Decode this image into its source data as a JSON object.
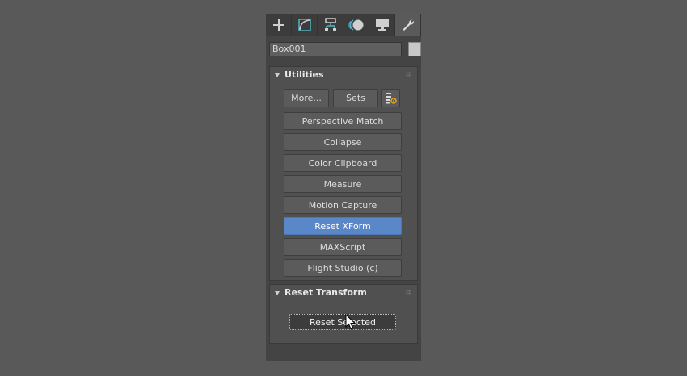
{
  "command_panel": {
    "tabs": [
      {
        "name": "create-tab",
        "icon": "plus-icon"
      },
      {
        "name": "modify-tab",
        "icon": "modify-curve-icon"
      },
      {
        "name": "hierarchy-tab",
        "icon": "hierarchy-icon"
      },
      {
        "name": "motion-tab",
        "icon": "motion-icon"
      },
      {
        "name": "display-tab",
        "icon": "monitor-icon"
      },
      {
        "name": "utilities-tab",
        "icon": "wrench-icon",
        "active": true
      }
    ],
    "object_name": "Box001",
    "object_color": "#c8c8c8"
  },
  "utilities": {
    "title": "Utilities",
    "more_label": "More...",
    "sets_label": "Sets",
    "config_icon": "configure-button-sets-icon",
    "buttons": [
      "Perspective Match",
      "Collapse",
      "Color Clipboard",
      "Measure",
      "Motion Capture",
      "Reset XForm",
      "MAXScript",
      "Flight Studio (c)"
    ],
    "selected": "Reset XForm",
    "selected_color": "#5a87c7"
  },
  "reset_transform": {
    "title": "Reset Transform",
    "reset_selected_label": "Reset Selected"
  }
}
